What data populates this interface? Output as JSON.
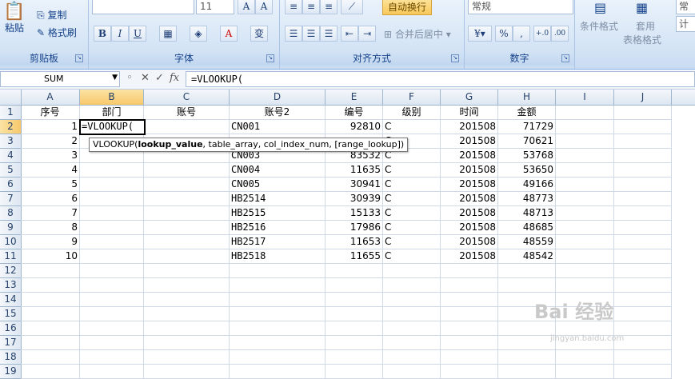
{
  "ribbon": {
    "clipboard": {
      "paste": "粘贴",
      "copy": "复制",
      "format_painter": "格式刷",
      "label": "剪贴板"
    },
    "font": {
      "size": "11",
      "bold": "B",
      "italic": "I",
      "underline": "U",
      "label": "字体",
      "pinyin": "变"
    },
    "alignment": {
      "wrap": "自动换行",
      "merge": "合并后居中",
      "label": "对齐方式"
    },
    "number": {
      "format": "常规",
      "label": "数字",
      "percent": "%",
      "comma": ",",
      "inc": "+.0",
      "dec": ".00"
    },
    "styles": {
      "cond": "条件格式",
      "table1": "套用",
      "table2": "表格格式",
      "cell_style": "常",
      "calc": "计"
    }
  },
  "formula_bar": {
    "name_box": "SUM",
    "cancel": "✕",
    "enter": "✓",
    "fx": "fx",
    "content": "=VLOOKUP("
  },
  "columns": [
    "A",
    "B",
    "C",
    "D",
    "E",
    "F",
    "G",
    "H",
    "I",
    "J"
  ],
  "rows": [
    "1",
    "2",
    "3",
    "4",
    "5",
    "6",
    "7",
    "8",
    "9",
    "10",
    "11",
    "12",
    "13",
    "14",
    "15",
    "16",
    "17",
    "18",
    "19"
  ],
  "headers": {
    "A": "序号",
    "B": "部门",
    "C": "账号",
    "D": "账号2",
    "E": "编号",
    "F": "级别",
    "G": "时间",
    "H": "金额"
  },
  "data": [
    {
      "A": "1",
      "D": "CN001",
      "E": "92810",
      "F": "C",
      "G": "201508",
      "H": "71729"
    },
    {
      "A": "2",
      "D": "",
      "E": "",
      "F": "C",
      "G": "201508",
      "H": "70621"
    },
    {
      "A": "3",
      "D": "CN003",
      "E": "83532",
      "F": "C",
      "G": "201508",
      "H": "53768"
    },
    {
      "A": "4",
      "D": "CN004",
      "E": "11635",
      "F": "C",
      "G": "201508",
      "H": "53650"
    },
    {
      "A": "5",
      "D": "CN005",
      "E": "30941",
      "F": "C",
      "G": "201508",
      "H": "49166"
    },
    {
      "A": "6",
      "D": "HB2514",
      "E": "30939",
      "F": "C",
      "G": "201508",
      "H": "48773"
    },
    {
      "A": "7",
      "D": "HB2515",
      "E": "15133",
      "F": "C",
      "G": "201508",
      "H": "48713"
    },
    {
      "A": "8",
      "D": "HB2516",
      "E": "17986",
      "F": "C",
      "G": "201508",
      "H": "48685"
    },
    {
      "A": "9",
      "D": "HB2517",
      "E": "11653",
      "F": "C",
      "G": "201508",
      "H": "48559"
    },
    {
      "A": "10",
      "D": "HB2518",
      "E": "11655",
      "F": "C",
      "G": "201508",
      "H": "48542"
    }
  ],
  "active_cell": {
    "ref": "B2",
    "content": "=VLOOKUP("
  },
  "tooltip": {
    "fn": "VLOOKUP(",
    "arg1": "lookup_value",
    "rest": ", table_array, col_index_num, [range_lookup])"
  },
  "watermark": {
    "text": "Bai 经验",
    "sub": "jingyan.baidu.com"
  },
  "colors": {
    "selection_header": "#f7c86a",
    "ribbon_text": "#15428b",
    "grid_line": "#d0d7e5"
  }
}
